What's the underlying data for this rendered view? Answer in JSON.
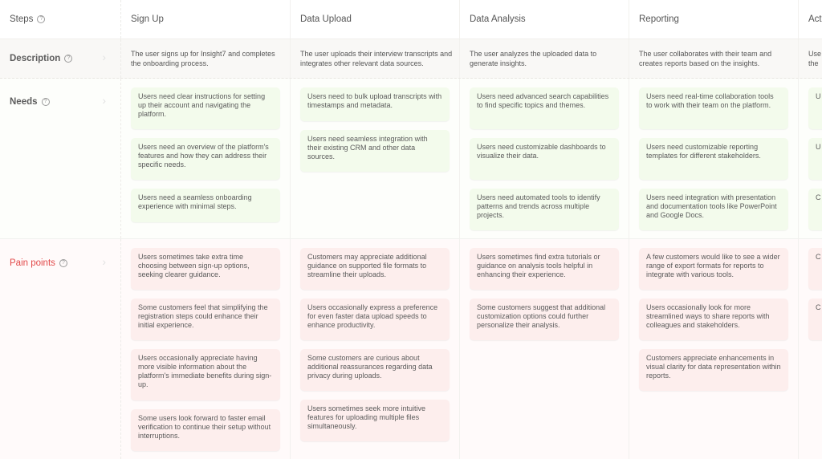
{
  "rows": {
    "steps": {
      "label": "Steps"
    },
    "description": {
      "label": "Description"
    },
    "needs": {
      "label": "Needs"
    },
    "pain_points": {
      "label": "Pain points"
    }
  },
  "colors": {
    "needs_card_bg": "#f3fbec",
    "pain_card_bg": "#fdeeed",
    "pain_label": "#e24a4a"
  },
  "icons": {
    "help": "?",
    "chevron": "›"
  },
  "columns": [
    {
      "title": "Sign Up",
      "description": "The user signs up for Insight7 and completes the onboarding process.",
      "needs": [
        "Users need clear instructions for setting up their account and navigating the platform.",
        "Users need an overview of the platform's features and how they can address their specific needs.",
        "Users need a seamless onboarding experience with minimal steps."
      ],
      "pain_points": [
        "Users sometimes take extra time choosing between sign-up options, seeking clearer guidance.",
        "Some customers feel that simplifying the registration steps could enhance their initial experience.",
        "Users occasionally appreciate having more visible information about the platform's immediate benefits during sign-up.",
        "Some users look forward to faster email verification to continue their setup without interruptions."
      ]
    },
    {
      "title": "Data Upload",
      "description": "The user uploads their interview transcripts and integrates other relevant data sources.",
      "needs": [
        "Users need to bulk upload transcripts with timestamps and metadata.",
        "Users need seamless integration with their existing CRM and other data sources."
      ],
      "pain_points": [
        "Customers may appreciate additional guidance on supported file formats to streamline their uploads.",
        "Users occasionally express a preference for even faster data upload speeds to enhance productivity.",
        "Some customers are curious about additional reassurances regarding data privacy during uploads.",
        "Users sometimes seek more intuitive features for uploading multiple files simultaneously."
      ]
    },
    {
      "title": "Data Analysis",
      "description": "The user analyzes the uploaded data to generate insights.",
      "needs": [
        "Users need advanced search capabilities to find specific topics and themes.",
        "Users need customizable dashboards to visualize their data.",
        "Users need automated tools to identify patterns and trends across multiple projects."
      ],
      "pain_points": [
        "Users sometimes find extra tutorials or guidance on analysis tools helpful in enhancing their experience.",
        "Some customers suggest that additional customization options could further personalize their analysis."
      ]
    },
    {
      "title": "Reporting",
      "description": "The user collaborates with their team and creates reports based on the insights.",
      "needs": [
        "Users need real-time collaboration tools to work with their team on the platform.",
        "Users need customizable reporting templates for different stakeholders.",
        "Users need integration with presentation and documentation tools like PowerPoint and Google Docs."
      ],
      "pain_points": [
        "A few customers would like to see a wider range of export formats for reports to integrate with various tools.",
        "Users occasionally look for more streamlined ways to share reports with colleagues and stakeholders.",
        "Customers appreciate enhancements in visual clarity for data representation within reports."
      ]
    },
    {
      "title": "Act",
      "description": "Use the",
      "needs": [
        "U q th",
        "U w ac",
        "C ac"
      ],
      "pain_points": [
        "C ab ca",
        "C cl a"
      ]
    }
  ]
}
